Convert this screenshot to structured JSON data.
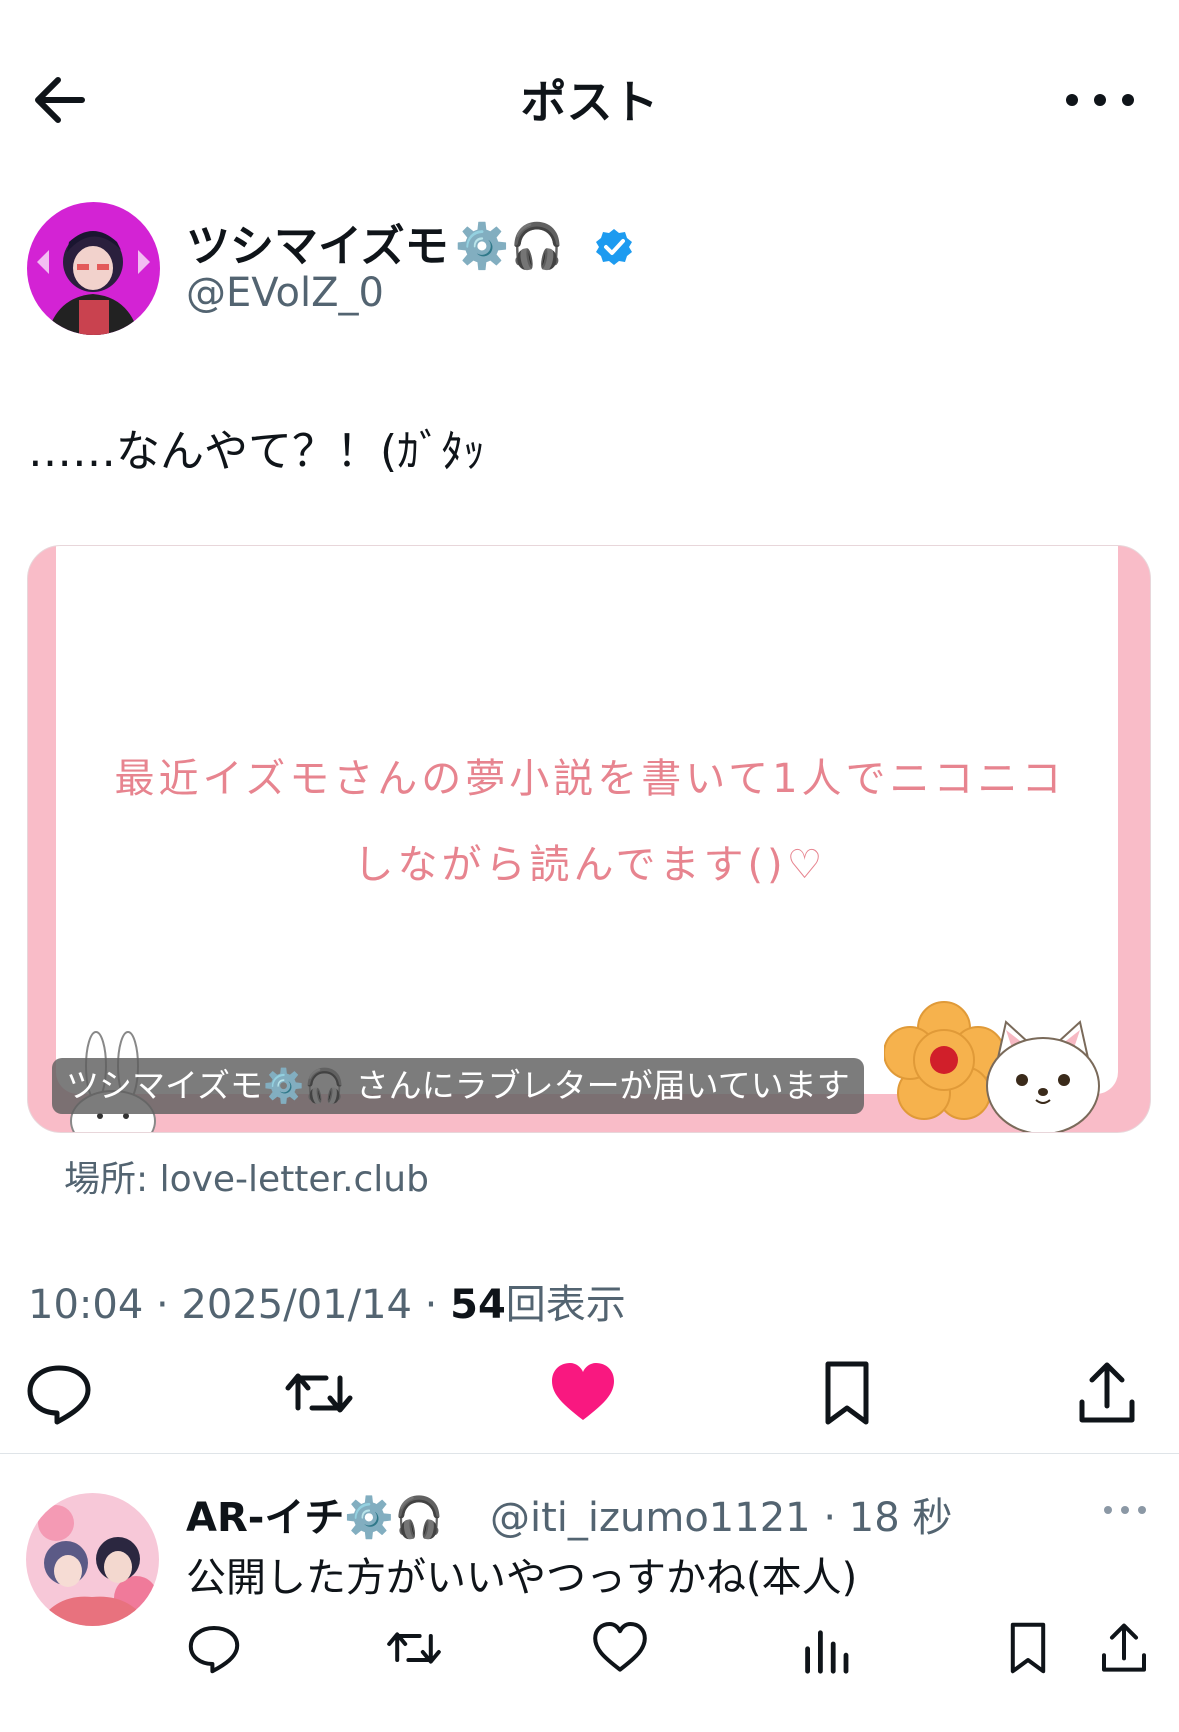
{
  "header": {
    "title": "ポスト"
  },
  "post": {
    "author_name": "ツシマイズモ",
    "author_emoji": "⚙️🎧",
    "author_handle": "@EVolZ_0",
    "text": "……なんやて？！(ｶﾞﾀｯ",
    "card": {
      "line1": "最近イズモさんの夢小説を書いて1人でニコニコ",
      "line2": "しながら読んでます()♡",
      "banner": "ツシマイズモ⚙️🎧 さんにラブレターが届いています",
      "domain": "場所: love-letter.club"
    },
    "time": "10:04 · 2025/01/14 · ",
    "views_count": "54",
    "views_label": "回表示",
    "liked": true
  },
  "reply": {
    "author_name": "AR-イチ",
    "author_emoji": "⚙️🎧",
    "handle_time": "@iti_izumo1121 · 18 秒",
    "text": "公開した方がいいやつっすかね(本人)"
  },
  "colors": {
    "like": "#f91880",
    "verified": "#1d9bf0",
    "card_pink": "#f9bcc8",
    "card_text": "#e7848f"
  },
  "icons": [
    "back-arrow-icon",
    "more-icon",
    "verified-icon",
    "reply-icon",
    "retweet-icon",
    "heart-icon",
    "bookmark-icon",
    "share-icon",
    "views-icon"
  ]
}
